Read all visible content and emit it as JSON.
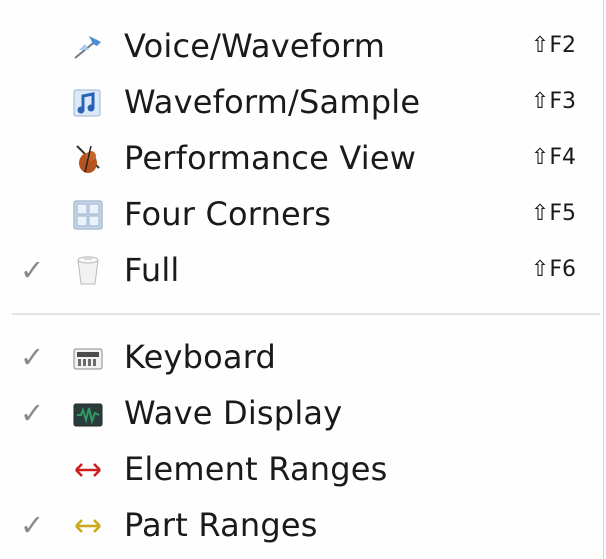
{
  "menu": {
    "view_items": [
      {
        "label": "Voice/Waveform",
        "shortcut": "⇧F2",
        "checked": "",
        "icon": "waveform-pin-icon"
      },
      {
        "label": "Waveform/Sample",
        "shortcut": "⇧F3",
        "checked": "",
        "icon": "music-note-icon"
      },
      {
        "label": "Performance View",
        "shortcut": "⇧F4",
        "checked": "",
        "icon": "violin-icon"
      },
      {
        "label": "Four Corners",
        "shortcut": "⇧F5",
        "checked": "",
        "icon": "grid-icon"
      },
      {
        "label": "Full",
        "shortcut": "⇧F6",
        "checked": "✓",
        "icon": "cup-icon"
      }
    ],
    "panel_items": [
      {
        "label": "Keyboard",
        "checked": "✓",
        "icon": "keyboard-icon"
      },
      {
        "label": "Wave Display",
        "checked": "✓",
        "icon": "wave-display-icon"
      },
      {
        "label": "Element Ranges",
        "checked": "",
        "icon": "red-range-arrow-icon"
      },
      {
        "label": "Part Ranges",
        "checked": "✓",
        "icon": "yellow-range-arrow-icon"
      }
    ],
    "colors": {
      "element_range": "#cc1f1f",
      "part_range": "#c8a818",
      "wave_display": "#2f9a62"
    }
  }
}
